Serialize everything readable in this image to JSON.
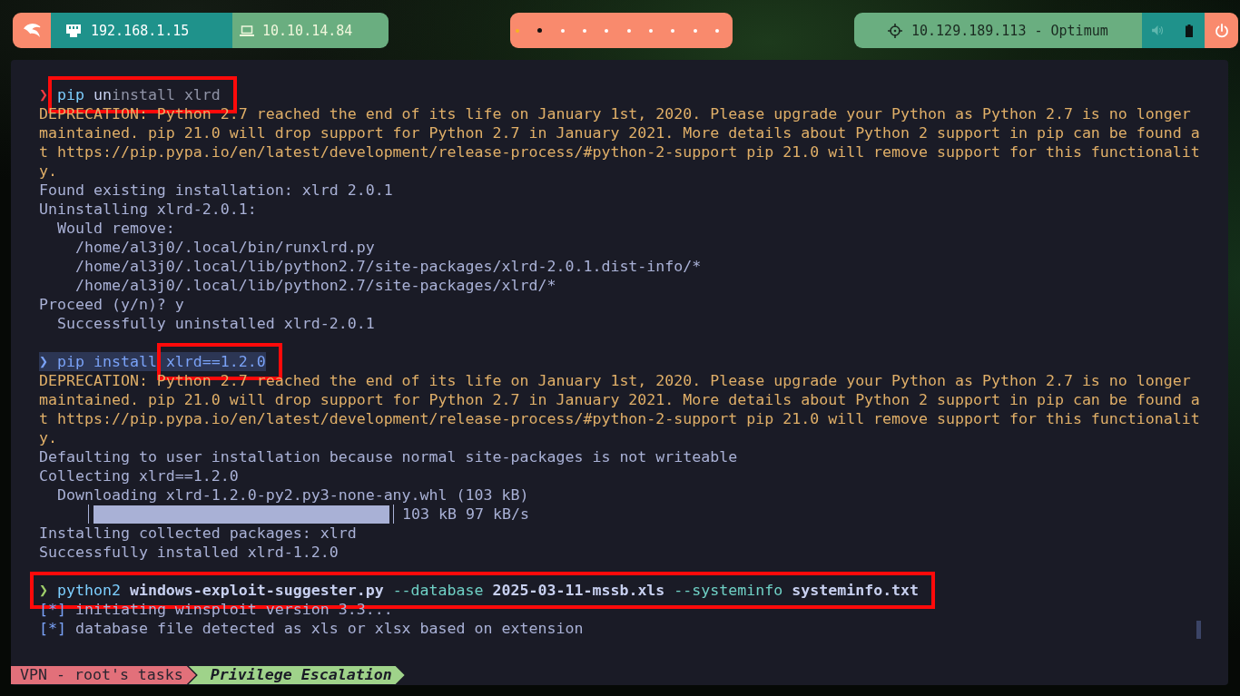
{
  "top_bar": {
    "connections": [
      {
        "kind": "ethernet",
        "address": "192.168.1.15"
      },
      {
        "kind": "vpn",
        "address": "10.10.14.84"
      }
    ],
    "workspaces": [
      {
        "selected": true,
        "occupied": false
      },
      {
        "selected": false,
        "occupied": true
      },
      {
        "selected": false,
        "occupied": false
      },
      {
        "selected": false,
        "occupied": false
      },
      {
        "selected": false,
        "occupied": false
      },
      {
        "selected": false,
        "occupied": false
      },
      {
        "selected": false,
        "occupied": false
      },
      {
        "selected": false,
        "occupied": false
      },
      {
        "selected": false,
        "occupied": false
      },
      {
        "selected": false,
        "occupied": false
      }
    ],
    "target": "10.129.189.113 - Optimum"
  },
  "terminal": {
    "blocks": [
      {
        "lines": [
          {
            "kind": "prompt",
            "failed": true,
            "selected": false,
            "parts": [
              {
                "boxed": false,
                "segments": [
                  {
                    "text": "❯ ",
                    "kind": "prompt"
                  }
                ]
              },
              {
                "boxed": true,
                "segments": [
                  {
                    "text": "pip",
                    "kind": "command"
                  },
                  {
                    "text": " un",
                    "kind": "typed"
                  },
                  {
                    "text": "install xlrd",
                    "kind": "suggestion"
                  }
                ]
              }
            ]
          },
          {
            "kind": "output",
            "segments": [
              {
                "text": "DEPRECATION: Python 2.7 reached the end of its life on January 1st, 2020. Please upgrade your Python as Python 2.7 is no longer",
                "kind": "warning"
              }
            ]
          },
          {
            "kind": "output",
            "segments": [
              {
                "text": "maintained. pip 21.0 will drop support for Python 2.7 in January 2021. More details about Python 2 support in pip can be found a",
                "kind": "warning"
              }
            ]
          },
          {
            "kind": "output",
            "segments": [
              {
                "text": "t https://pip.pypa.io/en/latest/development/release-process/#python-2-support pip 21.0 will remove support for this functionalit",
                "kind": "warning"
              }
            ]
          },
          {
            "kind": "output",
            "segments": [
              {
                "text": "y.",
                "kind": "warning"
              }
            ]
          },
          {
            "kind": "output",
            "segments": [
              {
                "text": "Found existing installation: xlrd 2.0.1",
                "kind": "plain"
              }
            ]
          },
          {
            "kind": "output",
            "segments": [
              {
                "text": "Uninstalling xlrd-2.0.1:",
                "kind": "plain"
              }
            ]
          },
          {
            "kind": "output",
            "segments": [
              {
                "text": "  Would remove:",
                "kind": "plain"
              }
            ]
          },
          {
            "kind": "output",
            "segments": [
              {
                "text": "    /home/al3j0/.local/bin/runxlrd.py",
                "kind": "plain"
              }
            ]
          },
          {
            "kind": "output",
            "segments": [
              {
                "text": "    /home/al3j0/.local/lib/python2.7/site-packages/xlrd-2.0.1.dist-info/*",
                "kind": "plain"
              }
            ]
          },
          {
            "kind": "output",
            "segments": [
              {
                "text": "    /home/al3j0/.local/lib/python2.7/site-packages/xlrd/*",
                "kind": "plain"
              }
            ]
          },
          {
            "kind": "output",
            "segments": [
              {
                "text": "Proceed (y/n)? y",
                "kind": "plain"
              }
            ]
          },
          {
            "kind": "output",
            "segments": [
              {
                "text": "  Successfully uninstalled xlrd-2.0.1",
                "kind": "plain"
              }
            ]
          }
        ]
      },
      {
        "lines": [
          {
            "kind": "prompt",
            "selected": true,
            "parts": [
              {
                "boxed": false,
                "segments": [
                  {
                    "text": "❯ pip install "
                  }
                ]
              },
              {
                "boxed": true,
                "segments": [
                  {
                    "text": "xlrd==1.2.0"
                  }
                ]
              }
            ]
          },
          {
            "kind": "output",
            "segments": [
              {
                "text": "DEPRECATION: Python 2.7 reached the end of its life on January 1st, 2020. Please upgrade your Python as Python 2.7 is no longer",
                "kind": "warning"
              }
            ]
          },
          {
            "kind": "output",
            "segments": [
              {
                "text": "maintained. pip 21.0 will drop support for Python 2.7 in January 2021. More details about Python 2 support in pip can be found a",
                "kind": "warning"
              }
            ]
          },
          {
            "kind": "output",
            "segments": [
              {
                "text": "t https://pip.pypa.io/en/latest/development/release-process/#python-2-support pip 21.0 will remove support for this functionalit",
                "kind": "warning"
              }
            ]
          },
          {
            "kind": "output",
            "segments": [
              {
                "text": "y.",
                "kind": "warning"
              }
            ]
          },
          {
            "kind": "output",
            "segments": [
              {
                "text": "Defaulting to user installation because normal site-packages is not writeable",
                "kind": "plain"
              }
            ]
          },
          {
            "kind": "output",
            "segments": [
              {
                "text": "Collecting xlrd==1.2.0",
                "kind": "plain"
              }
            ]
          },
          {
            "kind": "output",
            "segments": [
              {
                "text": "  Downloading xlrd-1.2.0-py2.py3-none-any.whl (103 kB)",
                "kind": "plain"
              }
            ]
          },
          {
            "kind": "progress",
            "level": 1,
            "reading": "103 kB 97 kB/s"
          },
          {
            "kind": "output",
            "segments": [
              {
                "text": "Installing collected packages: xlrd",
                "kind": "plain"
              }
            ]
          },
          {
            "kind": "output",
            "segments": [
              {
                "text": "Successfully installed xlrd-1.2.0",
                "kind": "plain"
              }
            ]
          }
        ]
      },
      {
        "lines": [
          {
            "kind": "prompt",
            "failed": false,
            "selected": false,
            "parts": [
              {
                "boxed": true,
                "segments": [
                  {
                    "text": "❯ ",
                    "kind": "prompt"
                  },
                  {
                    "text": "python2",
                    "kind": "command"
                  },
                  {
                    "text": " windows-exploit-suggester.py",
                    "kind": "argument"
                  },
                  {
                    "text": " --database",
                    "kind": "option"
                  },
                  {
                    "text": " 2025-03-11-mssb.xls",
                    "kind": "argument"
                  },
                  {
                    "text": " --systeminfo",
                    "kind": "option"
                  },
                  {
                    "text": " systeminfo.txt",
                    "kind": "argument"
                  }
                ]
              }
            ]
          },
          {
            "kind": "output",
            "segments": [
              {
                "text": "[*]",
                "kind": "marker"
              },
              {
                "text": " initiating winsploit version 3.3...",
                "kind": "plain"
              }
            ]
          },
          {
            "kind": "output",
            "segments": [
              {
                "text": "[*]",
                "kind": "marker"
              },
              {
                "text": " database file detected as xls or xlsx based on extension",
                "kind": "plain"
              }
            ]
          }
        ]
      }
    ]
  },
  "tabs": [
    {
      "label": "VPN - root's tasks",
      "selected": false
    },
    {
      "label": "Privilege Escalation",
      "selected": true
    }
  ]
}
